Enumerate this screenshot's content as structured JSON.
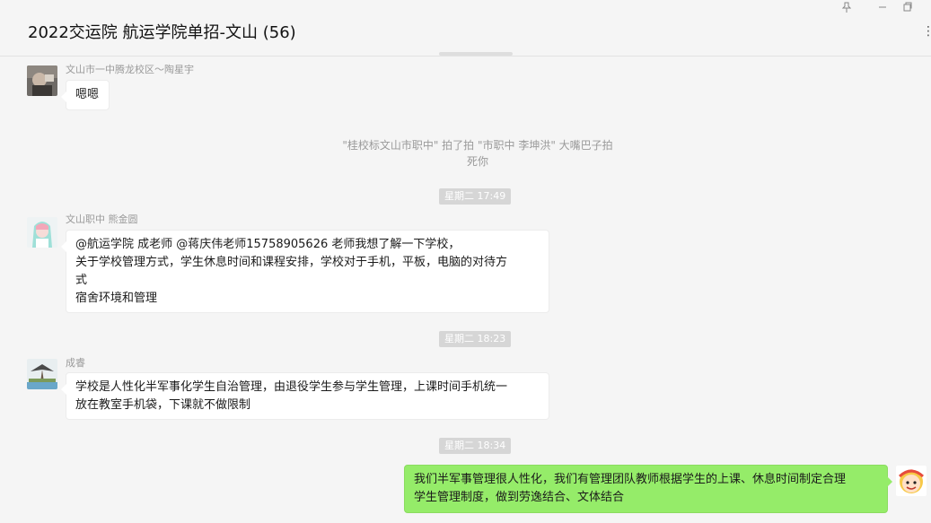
{
  "header": {
    "title": "2022交运院 航运学院单招-文山 (56)",
    "more_icon": "more-dots-icon"
  },
  "window_controls": {
    "pin_icon": "pin-icon",
    "restore_icon": "restore-icon"
  },
  "messages": [
    {
      "type": "text",
      "sender": "文山市一中腾龙校区～陶星宇",
      "lines": [
        "嗯嗯"
      ]
    },
    {
      "type": "system",
      "lines": [
        "\"桂校标文山市职中\" 拍了拍 \"市职中 李坤洪\" 大嘴巴子拍",
        "死你"
      ]
    },
    {
      "type": "time",
      "text": "星期二 17:49"
    },
    {
      "type": "text",
      "sender": "文山职中                    熊金圆",
      "lines": [
        "@航运学院 成老师 @蒋庆伟老师15758905626 老师我想了解一下学校，",
        "关于学校管理方式，学生休息时间和课程安排，学校对于手机，平板，电脑的对待方",
        "式",
        "宿舍环境和管理"
      ]
    },
    {
      "type": "time",
      "text": "星期二 18:23"
    },
    {
      "type": "text",
      "sender": "成睿",
      "lines": [
        "学校是人性化半军事化学生自治管理，由退役学生参与学生管理，上课时间手机统一",
        "放在教室手机袋，下课就不做限制"
      ]
    },
    {
      "type": "time",
      "text": "星期二 18:34"
    },
    {
      "type": "text",
      "self": true,
      "lines": [
        "我们半军事管理很人性化，我们有管理团队教师根据学生的上课、休息时间制定合理",
        "学生管理制度，做到劳逸结合、文体结合"
      ]
    }
  ],
  "colors": {
    "self_bubble": "#95ec69",
    "other_bubble": "#ffffff",
    "background": "#f5f5f5"
  }
}
